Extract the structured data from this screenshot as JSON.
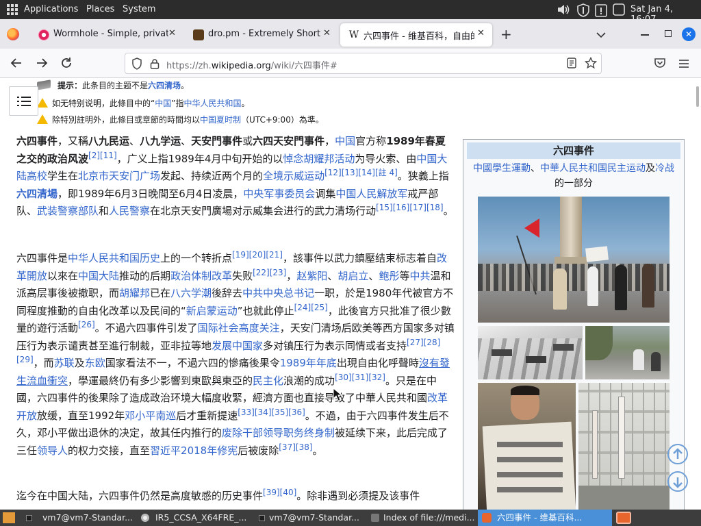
{
  "panel": {
    "menus": [
      "Applications",
      "Places",
      "System"
    ],
    "clock": "Sat Jan  4, 16:07"
  },
  "tabs": [
    {
      "title": "Wormhole - Simple, private"
    },
    {
      "title": "dro.pm - Extremely Short Li"
    },
    {
      "title": "六四事件 - 维基百科，自由的"
    }
  ],
  "url": {
    "prefix": "https://zh.",
    "domain": "wikipedia.org",
    "path": "/wiki/六四事件#"
  },
  "hatnotes": {
    "hint_label": "提示：",
    "hint_text": "此条目的主题不是",
    "hint_link": "六四清场",
    "hint_end": "。",
    "note2_a": "如无特别说明，此條目中的",
    "note2_link1": "中国",
    "note2_b": "指",
    "note2_link2": "中华人民共和国",
    "note2_c": "。",
    "note3_a": "除特別註明外，此條目或章節的時間均以",
    "note3_link": "中国夏时制",
    "note3_b": "（UTC+9:00）為準。"
  },
  "infobox": {
    "title": "六四事件",
    "subtitle_links": [
      "中國學生運動",
      "中華人民共和国民主运动",
      "冷战"
    ],
    "subtitle_and": "及",
    "subtitle_sep": "、",
    "subtitle_end": "的一部分"
  },
  "taskbar": {
    "items": [
      "vm7@vm7-Standar...",
      "IR5_CCSA_X64FRE_...",
      "vm7@vm7-Standar...",
      "Index of file:///medi...",
      "六四事件 - 维基百科..."
    ]
  },
  "colors": {
    "link": "#3366cc",
    "text": "#202122",
    "panel": "#2c2c2c",
    "tabstrip": "#e8e7ec",
    "taskbar": "#3d3d3d",
    "taskbar_active": "#4a90d9",
    "infobox_header": "#cedff2"
  }
}
